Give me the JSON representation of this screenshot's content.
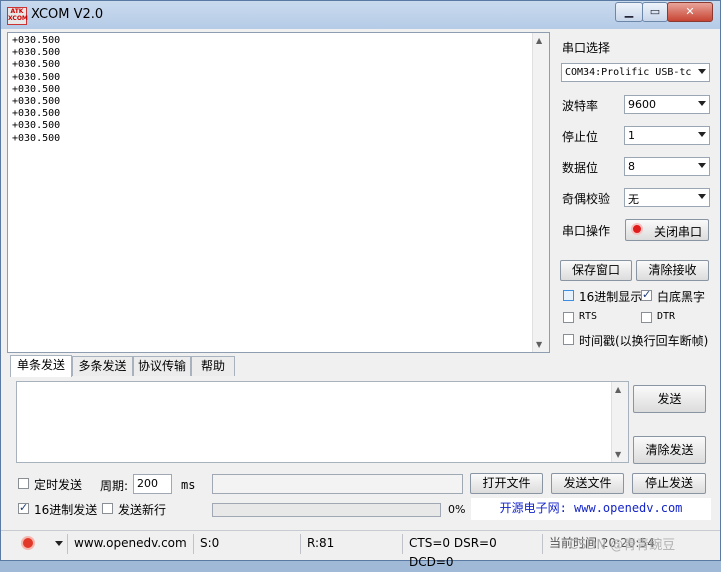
{
  "window": {
    "title": "XCOM V2.0",
    "icon_text_top": "ATK",
    "icon_text_bottom": "XCOM",
    "icon": "app-icon"
  },
  "recv": {
    "lines": [
      "+030.500",
      "+030.500",
      "+030.500",
      "+030.500",
      "+030.500",
      "+030.500",
      "+030.500",
      "+030.500",
      "+030.500"
    ]
  },
  "panel": {
    "port_select_label": "串口选择",
    "port_value": "COM34:Prolific USB-tc",
    "baud_label": "波特率",
    "baud_value": "9600",
    "stop_label": "停止位",
    "stop_value": "1",
    "data_label": "数据位",
    "data_value": "8",
    "parity_label": "奇偶校验",
    "parity_value": "无",
    "op_label": "串口操作",
    "op_button": "关闭串口",
    "save_button": "保存窗口",
    "clear_recv_button": "清除接收",
    "hex_display": "16进制显示",
    "hex_display_checked": false,
    "white_black": "白底黑字",
    "white_black_checked": true,
    "rts": "RTS",
    "dtr": "DTR",
    "timestamp": "时间戳(以换行回车断帧)"
  },
  "tabs": [
    "单条发送",
    "多条发送",
    "协议传输",
    "帮助"
  ],
  "send": {
    "send_button": "发送",
    "clear_send_button": "清除发送",
    "timed_send": "定时发送",
    "period_label": "周期:",
    "period_value": "200",
    "period_unit": "ms",
    "open_file": "打开文件",
    "send_file": "发送文件",
    "stop_send": "停止发送",
    "hex_send": "16进制发送",
    "hex_send_checked": true,
    "newline": "发送新行",
    "newline_checked": false,
    "progress": "0%",
    "promo": "开源电子网: www.openedv.com"
  },
  "status": {
    "url": "www.openedv.com",
    "s": "S:0",
    "r": "R:81",
    "lines": "CTS=0 DSR=0 DCD=0",
    "time": "当前时间 20:20:54"
  },
  "watermark": "CSDN @青青豌豆"
}
